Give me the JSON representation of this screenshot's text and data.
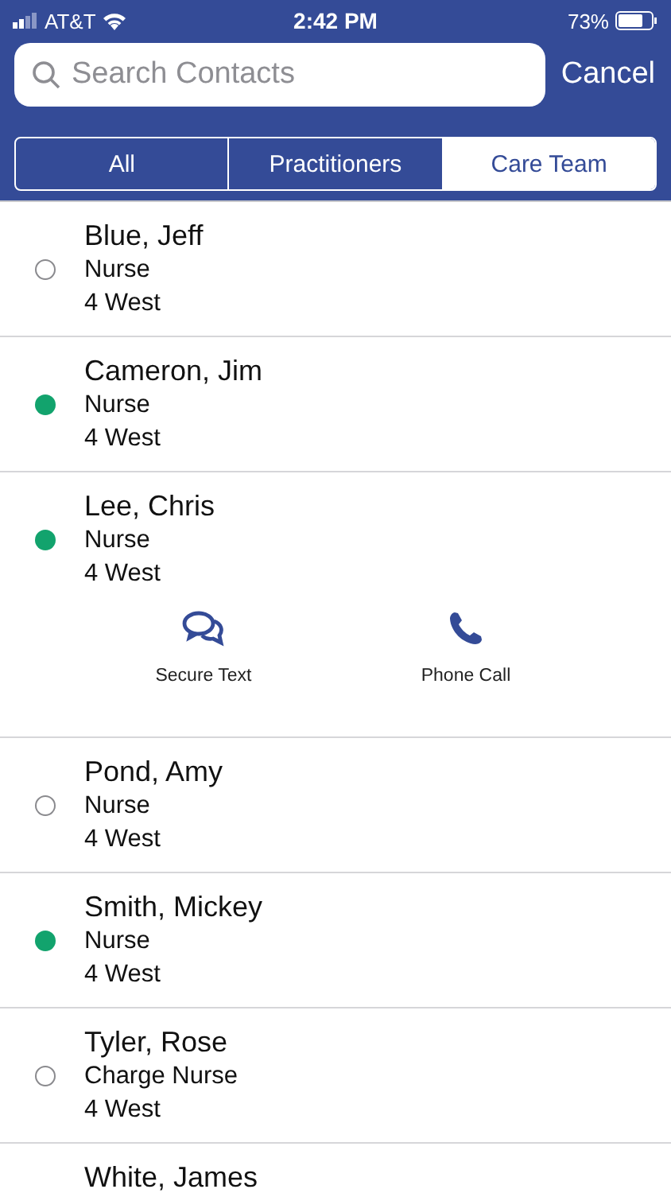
{
  "status_bar": {
    "carrier": "AT&T",
    "time": "2:42 PM",
    "battery": "73%"
  },
  "search": {
    "placeholder": "Search Contacts",
    "cancel": "Cancel"
  },
  "tabs": [
    {
      "label": "All",
      "selected": false
    },
    {
      "label": "Practitioners",
      "selected": false
    },
    {
      "label": "Care Team",
      "selected": true
    }
  ],
  "contacts": [
    {
      "name": "Blue, Jeff",
      "role": "Nurse",
      "unit": "4 West",
      "online": false
    },
    {
      "name": "Cameron, Jim",
      "role": "Nurse",
      "unit": "4 West",
      "online": true
    },
    {
      "name": "Lee, Chris",
      "role": "Nurse",
      "unit": "4 West",
      "online": true,
      "actions": [
        {
          "kind": "text",
          "label": "Secure Text"
        },
        {
          "kind": "call",
          "label": "Phone Call"
        }
      ]
    },
    {
      "name": "Pond, Amy",
      "role": "Nurse",
      "unit": "4 West",
      "online": false
    },
    {
      "name": "Smith, Mickey",
      "role": "Nurse",
      "unit": "4 West",
      "online": true
    },
    {
      "name": "Tyler, Rose",
      "role": "Charge Nurse",
      "unit": "4 West",
      "online": false
    },
    {
      "name": "White, James"
    }
  ]
}
